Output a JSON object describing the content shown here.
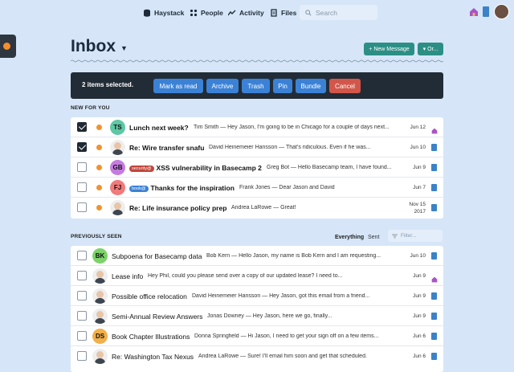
{
  "nav": {
    "haystack": "Haystack",
    "people": "People",
    "activity": "Activity",
    "files": "Files",
    "search_placeholder": "Search"
  },
  "header": {
    "title": "Inbox",
    "new_message": "+ New Message",
    "or": "Or..."
  },
  "selection": {
    "count_text": "2 items selected.",
    "mark_read": "Mark as read",
    "archive": "Archive",
    "trash": "Trash",
    "pin": "Pin",
    "bundle": "Bundle",
    "cancel": "Cancel"
  },
  "sections": {
    "new_for_you": "NEW FOR YOU",
    "previously_seen": "PREVIOUSLY SEEN",
    "everything": "Everything",
    "sent": "Sent",
    "filter_placeholder": "Filter..."
  },
  "new_items": [
    {
      "initials": "TS",
      "avatar_color": "#5ec7a4",
      "subject": "Lunch next week?",
      "badge": "",
      "snippet": "Tim Smith — Hey Jason, I'm going to be in Chicago for a couple of days next...",
      "date": "Jun 12",
      "date2": "",
      "checked": true,
      "icon": "hey-icon"
    },
    {
      "initials": "",
      "avatar_color": "#ddd",
      "subject": "Re: Wire transfer snafu",
      "badge": "",
      "snippet": "David Heinemeier Hansson — That's ridiculous. Even if he was...",
      "date": "Jun 10",
      "date2": "",
      "checked": true,
      "icon": "doc-icon"
    },
    {
      "initials": "GB",
      "avatar_color": "#c57be0",
      "subject": "XSS vulnerability in Basecamp 2",
      "badge": "security@",
      "snippet": "Greg Bot — Hello Basecamp team, I have found...",
      "date": "Jun 9",
      "date2": "",
      "checked": false,
      "icon": "doc-icon"
    },
    {
      "initials": "FJ",
      "avatar_color": "#f27a7a",
      "subject": "Thanks for the inspiration",
      "badge": "book@",
      "snippet": "Frank Jones — Dear Jason and David",
      "date": "Jun 7",
      "date2": "",
      "checked": false,
      "icon": "doc-icon"
    },
    {
      "initials": "",
      "avatar_color": "#ddd",
      "subject": "Re: Life insurance policy prep",
      "badge": "",
      "snippet": "Andrea LaRowe — Great!",
      "date": "Nov 15",
      "date2": "2017",
      "checked": false,
      "icon": "doc-icon"
    }
  ],
  "seen_items": [
    {
      "initials": "BK",
      "avatar_color": "#7bd36a",
      "subject": "Subpoena for Basecamp data",
      "snippet": "Bob Kern — Hello Jason, my name is Bob Kern and I am requesting...",
      "date": "Jun 10",
      "icon": "doc-icon"
    },
    {
      "initials": "",
      "avatar_color": "#ddd",
      "subject": "Lease info",
      "snippet": "Hey Phil, could you please send over a copy of our updated lease? I need to...",
      "date": "Jun 9",
      "icon": "hey-icon"
    },
    {
      "initials": "",
      "avatar_color": "#ddd",
      "subject": "Possible office relocation",
      "snippet": "David Heinemeier Hansson — Hey Jason, got this email from a friend...",
      "date": "Jun 9",
      "icon": "doc-icon"
    },
    {
      "initials": "",
      "avatar_color": "#ddd",
      "subject": "Semi-Annual Review Answers",
      "snippet": "Jonas Downey — Hey Jason, here we go, finally...",
      "date": "Jun 9",
      "icon": "doc-icon"
    },
    {
      "initials": "DS",
      "avatar_color": "#f2b04a",
      "subject": "Book Chapter Illustrations",
      "snippet": "Donna Springfield — Hi Jason, I need to get your sign off on a few items...",
      "date": "Jun 6",
      "icon": "doc-icon"
    },
    {
      "initials": "",
      "avatar_color": "#ddd",
      "subject": "Re: Washington Tax Nexus",
      "snippet": "Andrea LaRowe — Sure! I'll email him soon and get that scheduled.",
      "date": "Jun 6",
      "icon": "doc-icon"
    }
  ]
}
